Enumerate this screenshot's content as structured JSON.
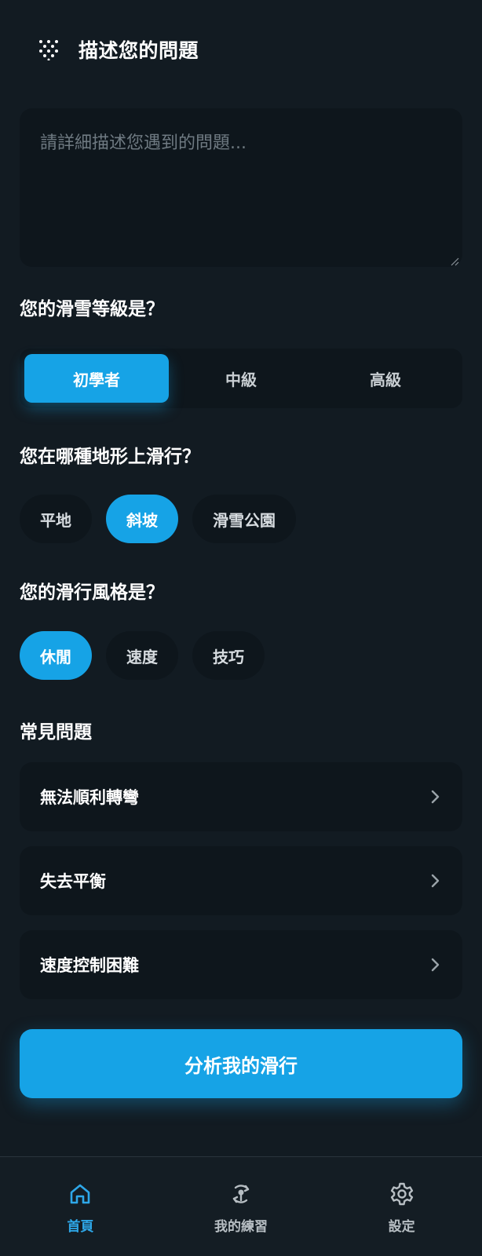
{
  "header": {
    "title": "描述您的問題",
    "icon": "dots-grid-icon"
  },
  "problem": {
    "placeholder": "請詳細描述您遇到的問題..."
  },
  "level": {
    "question": "您的滑雪等級是？",
    "options": [
      "初學者",
      "中級",
      "高級"
    ],
    "selected": "初學者"
  },
  "terrain": {
    "question": "您在哪種地形上滑行？",
    "options": [
      "平地",
      "斜坡",
      "滑雪公園"
    ],
    "selected": "斜坡"
  },
  "style": {
    "question": "您的滑行風格是？",
    "options": [
      "休閒",
      "速度",
      "技巧"
    ],
    "selected": "休閒"
  },
  "faq": {
    "title": "常見問題",
    "items": [
      "無法順利轉彎",
      "失去平衡",
      "速度控制困難"
    ]
  },
  "analyze_button": "分析我的滑行",
  "bottom_nav": {
    "items": [
      {
        "label": "首頁",
        "icon": "home-icon",
        "active": true
      },
      {
        "label": "我的練習",
        "icon": "practice-icon",
        "active": false
      },
      {
        "label": "設定",
        "icon": "gear-icon",
        "active": false
      }
    ]
  },
  "colors": {
    "accent": "#16a3e6",
    "background": "#121b22",
    "card": "#0e161c"
  }
}
